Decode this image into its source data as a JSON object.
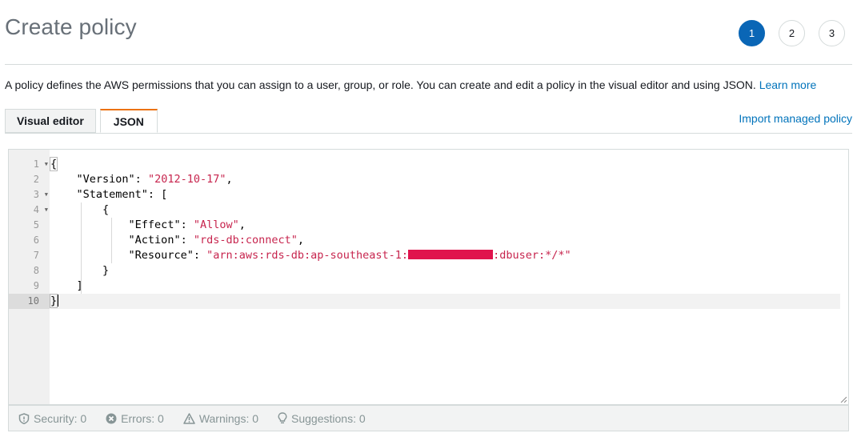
{
  "page": {
    "title": "Create policy"
  },
  "steps": [
    "1",
    "2",
    "3"
  ],
  "description": {
    "text": "A policy defines the AWS permissions that you can assign to a user, group, or role. You can create and edit a policy in the visual editor and using JSON.",
    "link": "Learn more"
  },
  "tabs": {
    "visual_editor": "Visual editor",
    "json": "JSON"
  },
  "import_link": "Import managed policy",
  "editor": {
    "line_numbers": [
      "1",
      "2",
      "3",
      "4",
      "5",
      "6",
      "7",
      "8",
      "9",
      "10"
    ],
    "lines": [
      {
        "indent": "",
        "key": "",
        "value": "",
        "tail": "{"
      },
      {
        "indent": "    ",
        "key": "\"Version\"",
        "value": "\"2012-10-17\"",
        "tail": ","
      },
      {
        "indent": "    ",
        "key": "\"Statement\"",
        "value": "",
        "tail": ": ["
      },
      {
        "indent": "        ",
        "key": "",
        "value": "",
        "tail": "{"
      },
      {
        "indent": "            ",
        "key": "\"Effect\"",
        "value": "\"Allow\"",
        "tail": ","
      },
      {
        "indent": "            ",
        "key": "\"Action\"",
        "value": "\"rds-db:connect\"",
        "tail": ","
      },
      {
        "indent": "            ",
        "key": "\"Resource\"",
        "value_prefix": "\"arn:aws:rds-db:ap-southeast-1:",
        "value_suffix": ":dbuser:*/*\""
      },
      {
        "indent": "        ",
        "key": "",
        "value": "",
        "tail": "}"
      },
      {
        "indent": "    ",
        "key": "",
        "value": "",
        "tail": "]"
      },
      {
        "indent": "",
        "key": "",
        "value": "",
        "tail": "}"
      }
    ],
    "redaction_color": "#e0134d"
  },
  "status_bar": {
    "security": "Security: 0",
    "errors": "Errors: 0",
    "warnings": "Warnings: 0",
    "suggestions": "Suggestions: 0"
  },
  "colors": {
    "accent": "#0a66b6",
    "tab_active_border": "#ec7211",
    "link": "#0073bb",
    "json_string": "#c7254e"
  }
}
